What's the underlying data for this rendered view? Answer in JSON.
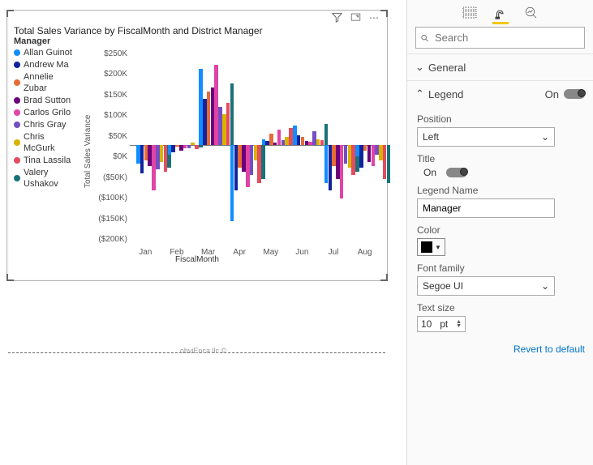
{
  "search": {
    "placeholder": "Search"
  },
  "sections": {
    "general": {
      "label": "General"
    },
    "legend": {
      "label": "Legend",
      "state": "On",
      "position_lbl": "Position",
      "position_val": "Left",
      "title_lbl": "Title",
      "title_state": "On",
      "name_lbl": "Legend Name",
      "name_val": "Manager",
      "color_lbl": "Color",
      "font_lbl": "Font family",
      "font_val": "Segoe UI",
      "size_lbl": "Text size",
      "size_val": "10",
      "size_unit": "pt",
      "revert": "Revert to default"
    }
  },
  "visual": {
    "footer_txt": "obviEnca llc ©"
  },
  "chart_data": {
    "type": "bar",
    "title": "Total Sales Variance by FiscalMonth and District Manager",
    "legend_title": "Manager",
    "xlabel": "FiscalMonth",
    "ylabel": "Total Sales Variance",
    "ylim": [
      -200000,
      250000
    ],
    "yticks": [
      "$250K",
      "$200K",
      "$150K",
      "$100K",
      "$50K",
      "$0K",
      "($50K)",
      "($100K)",
      "($150K)",
      "($200K)"
    ],
    "categories": [
      "Jan",
      "Feb",
      "Mar",
      "Apr",
      "May",
      "Jun",
      "Jul",
      "Aug"
    ],
    "series": [
      {
        "name": "Allan Guinot",
        "color": "#118dff",
        "values": [
          -50000,
          -25000,
          200000,
          -200000,
          15000,
          50000,
          -100000,
          -30000
        ]
      },
      {
        "name": "Andrew Ma",
        "color": "#12239e",
        "values": [
          -75000,
          -20000,
          120000,
          -120000,
          10000,
          25000,
          -120000,
          -60000
        ]
      },
      {
        "name": "Annelie Zubar",
        "color": "#e66c37",
        "values": [
          -40000,
          -5000,
          140000,
          -60000,
          30000,
          20000,
          -55000,
          -15000
        ]
      },
      {
        "name": "Brad Sutton",
        "color": "#6b007b",
        "values": [
          -55000,
          -15000,
          150000,
          -70000,
          5000,
          10000,
          -90000,
          -45000
        ]
      },
      {
        "name": "Carlos Grilo",
        "color": "#e044a7",
        "values": [
          -120000,
          -8000,
          210000,
          -110000,
          40000,
          8000,
          -140000,
          -55000
        ]
      },
      {
        "name": "Chris Gray",
        "color": "#744ec2",
        "values": [
          -65000,
          -10000,
          100000,
          -80000,
          12000,
          35000,
          -50000,
          -25000
        ]
      },
      {
        "name": "Chris McGurk",
        "color": "#d9b300",
        "values": [
          -45000,
          5000,
          80000,
          -40000,
          20000,
          15000,
          -60000,
          -40000
        ]
      },
      {
        "name": "Tina Lassila",
        "color": "#e54c5e",
        "values": [
          -70000,
          -12000,
          110000,
          -100000,
          45000,
          12000,
          -80000,
          -90000
        ]
      },
      {
        "name": "Valery Ushakov",
        "color": "#197278",
        "values": [
          -60000,
          -6000,
          160000,
          -90000,
          30000,
          55000,
          -70000,
          -100000
        ]
      }
    ]
  }
}
